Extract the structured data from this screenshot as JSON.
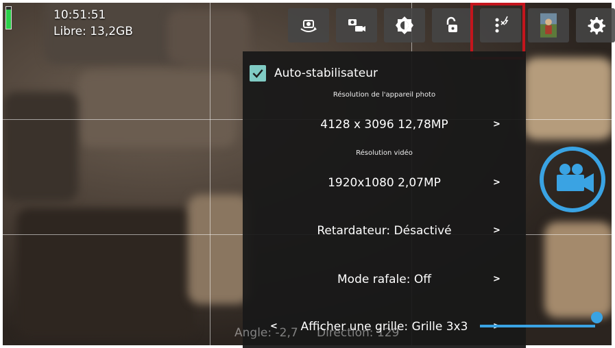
{
  "status": {
    "time": "10:51:51",
    "storage": "Libre: 13,2GB",
    "battery_level": 0.86
  },
  "toolbar": {
    "buttons": [
      {
        "name": "switch-camera-icon"
      },
      {
        "name": "photo-video-mode-icon"
      },
      {
        "name": "exposure-icon"
      },
      {
        "name": "exposure-lock-icon"
      },
      {
        "name": "popup-settings-icon"
      },
      {
        "name": "gallery-thumbnail-icon"
      },
      {
        "name": "settings-gear-icon"
      }
    ]
  },
  "popup": {
    "auto_stab": {
      "label": "Auto-stabilisateur",
      "checked": true
    },
    "photo_res_title": "Résolution de l'appareil photo",
    "photo_res_value": "4128 x 3096 12,78MP",
    "video_res_title": "Résolution vidéo",
    "video_res_value": "1920x1080 2,07MP",
    "timer": "Retardateur: Désactivé",
    "burst": "Mode rafale: Off",
    "grid": "Afficher une grille: Grille 3x3",
    "arrow_right": ">",
    "arrow_left": "<"
  },
  "overlay": {
    "angle": "Angle: -2,7",
    "direction": "Direction: 129"
  },
  "zoom": {
    "level": 1.0
  },
  "colors": {
    "accent": "#3aa3e3",
    "highlight": "#c4151c",
    "checkbox": "#80cbc4"
  }
}
